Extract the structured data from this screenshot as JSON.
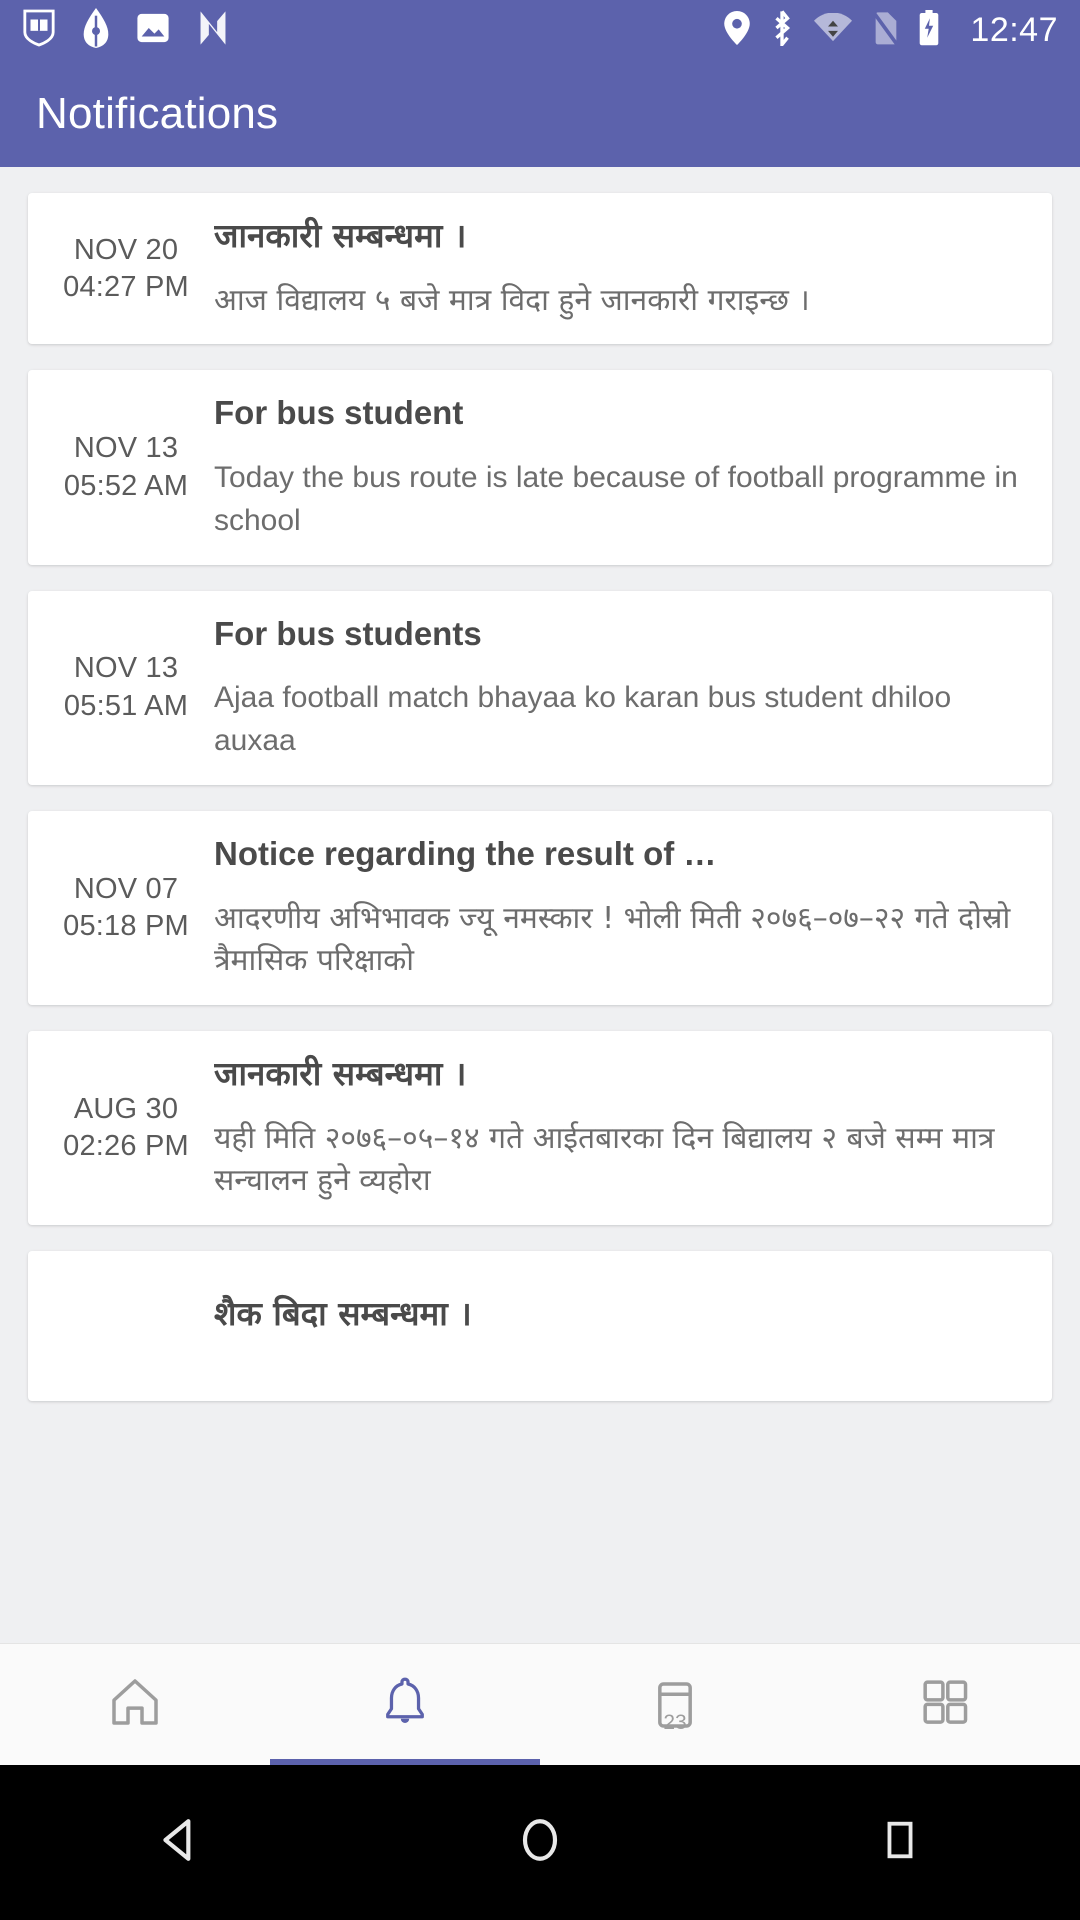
{
  "status_bar": {
    "time": "12:47",
    "left_icons": [
      "book-badge-icon",
      "pen-nib-icon",
      "image-icon",
      "n-logo-icon"
    ],
    "right_icons": [
      "location-pin-icon",
      "bluetooth-icon",
      "wifi-icon",
      "no-sim-icon",
      "battery-charging-icon"
    ],
    "colors": {
      "background": "#5c62ac",
      "foreground": "#ffffff"
    }
  },
  "app_bar": {
    "title": "Notifications",
    "background": "#5c62ac"
  },
  "notifications": [
    {
      "date": "NOV 20",
      "time": "04:27 PM",
      "title": "जानकारी सम्बन्धमा ।",
      "text": "आज विद्यालय ५ बजे मात्र विदा हुने जानकारी गराइन्छ ।",
      "script": "devanagari"
    },
    {
      "date": "NOV 13",
      "time": "05:52 AM",
      "title": "For bus student",
      "text": "Today the bus route is  late because of football programme in school",
      "script": "latin"
    },
    {
      "date": "NOV 13",
      "time": "05:51 AM",
      "title": "For bus students",
      "text": "Ajaa football match bhayaa ko karan bus student dhiloo auxaa",
      "script": "latin"
    },
    {
      "date": "NOV 07",
      "time": "05:18 PM",
      "title": "Notice regarding the result of …",
      "text": "आदरणीय अभिभावक ज्यू नमस्कार ! भोली मिती २०७६–०७–२२ गते दोस्रो त्रैमासिक परिक्षाको",
      "script": "devanagari"
    },
    {
      "date": "AUG 30",
      "time": "02:26 PM",
      "title": "जानकारी सम्बन्धमा ।",
      "text": "यही मिति २०७६–०५–१४ गते आईतबारका दिन बिद्यालय २ बजे सम्म मात्र सन्चालन हुने व्यहोरा",
      "script": "devanagari"
    },
    {
      "date": "",
      "time": "",
      "title": "शैक बिदा सम्बन्धमा ।",
      "text": "",
      "script": "devanagari"
    }
  ],
  "bottom_nav": {
    "active_index": 1,
    "active_color": "#5c62ac",
    "inactive_color": "#9d9d9d",
    "items": [
      {
        "icon": "home-icon",
        "label": ""
      },
      {
        "icon": "bell-icon",
        "label": ""
      },
      {
        "icon": "calendar-icon",
        "label": "",
        "badge": "23"
      },
      {
        "icon": "grid-icon",
        "label": ""
      }
    ]
  },
  "android_nav": {
    "items": [
      "back-triangle-icon",
      "home-circle-icon",
      "recents-square-icon"
    ],
    "background": "#000000"
  }
}
